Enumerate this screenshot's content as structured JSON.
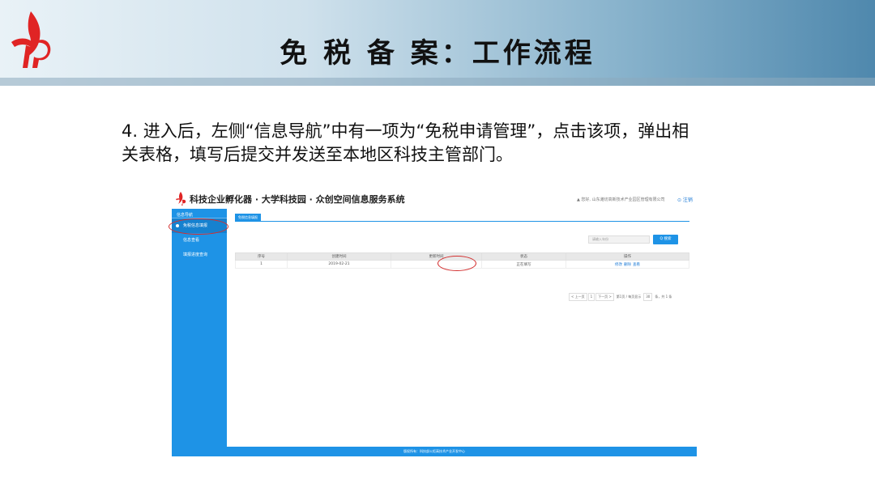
{
  "slide": {
    "title": "免 税 备 案：工作流程",
    "instruction_line1": "4. 进入后，左侧“信息导航”中有一项为“免税申请管理”，点击该项，弹出相",
    "instruction_line2": "关表格，填写后提交并发送至本地区科技主管部门。"
  },
  "app": {
    "title": "科技企业孵化器 · 大学科技园 · 众创空间信息服务系统",
    "user_info": "▲ 您好, 山东潍坊高新技术产业园区管理有限公司",
    "logout": "⊙ 注销"
  },
  "sidebar": {
    "header": "信息导航",
    "items": [
      {
        "label": "免税信息填报"
      },
      {
        "label": "信息查看"
      },
      {
        "label": "填报进度查询"
      }
    ]
  },
  "main": {
    "tab": "免税信息填报",
    "search_placeholder": "请输入年份",
    "search_button": "Q 搜索",
    "table": {
      "headers": [
        "序号",
        "创建时间",
        "更新时间",
        "状态",
        "操作"
      ],
      "rows": [
        {
          "no": "1",
          "created": "2019-02-21",
          "updated": "",
          "status": "正在填写",
          "ops": [
            "修改",
            "删除",
            "查看"
          ]
        }
      ]
    },
    "pager": {
      "prev": "< 上一页",
      "page": "1",
      "next": "下一页 >",
      "info": "第1页 / 每页显示",
      "size": "30",
      "total": "条，共 1 条"
    }
  },
  "footer": "版权所有：科技部火炬高技术产业开发中心",
  "colors": {
    "accent": "#1e93e6",
    "highlight": "#d32f2f",
    "logo_red": "#e02424"
  }
}
